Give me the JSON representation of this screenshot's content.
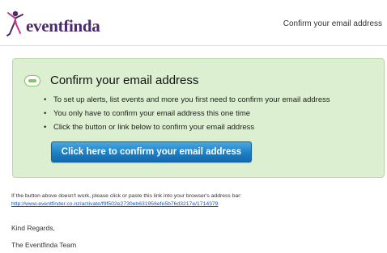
{
  "header": {
    "logo_text": "eventfinda",
    "title": "Confirm your email address"
  },
  "panel": {
    "title": "Confirm your email address",
    "bullets": [
      "To set up alerts, list events and more you first need to confirm your email address",
      "You only have to confirm your email address this one time",
      "Click the button or link below to confirm your email address"
    ],
    "button_label": "Click here to confirm your email address"
  },
  "footer": {
    "fallback_note": "If the button above doesn't work, please click or paste this link into your browser's address bar:",
    "fallback_link": "http://www.eventfinder.co.nz/activate/f9f502e2730eb631956efe5b76d3217e/1714379",
    "regards": "Kind Regards,",
    "signature": "The Eventfinda Team"
  },
  "colors": {
    "brand_purple": "#4a2a6b",
    "brand_magenta": "#c2378a",
    "panel_bg": "#dcefd0",
    "button_blue": "#1d7fc6",
    "link_blue": "#1a55b5"
  },
  "icons": {
    "logo": "dancing-figure-icon",
    "panel": "speech-bubble-icon"
  }
}
